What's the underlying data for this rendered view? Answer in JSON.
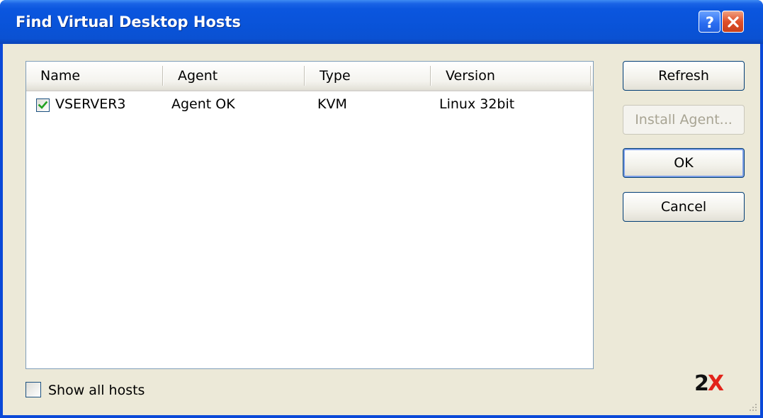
{
  "window": {
    "title": "Find Virtual Desktop Hosts"
  },
  "titlebar_buttons": {
    "help_icon": "help-icon",
    "close_icon": "close-icon"
  },
  "list": {
    "columns": [
      "Name",
      "Agent",
      "Type",
      "Version"
    ],
    "rows": [
      {
        "checked": true,
        "name": "VSERVER3",
        "agent": "Agent OK",
        "type": "KVM",
        "version": "Linux 32bit"
      }
    ]
  },
  "buttons": {
    "refresh_label": "Refresh",
    "install_label": "Install Agent...",
    "ok_label": "OK",
    "cancel_label": "Cancel"
  },
  "footer": {
    "show_all_label": "Show all hosts",
    "show_all_checked": false
  },
  "logo": {
    "text_main": "2",
    "text_accent": "X"
  },
  "colors": {
    "titlebar": "#0953d8",
    "dialog_bg": "#ece9d8",
    "logo_accent": "#e2231a",
    "check_mark": "#21a121"
  }
}
